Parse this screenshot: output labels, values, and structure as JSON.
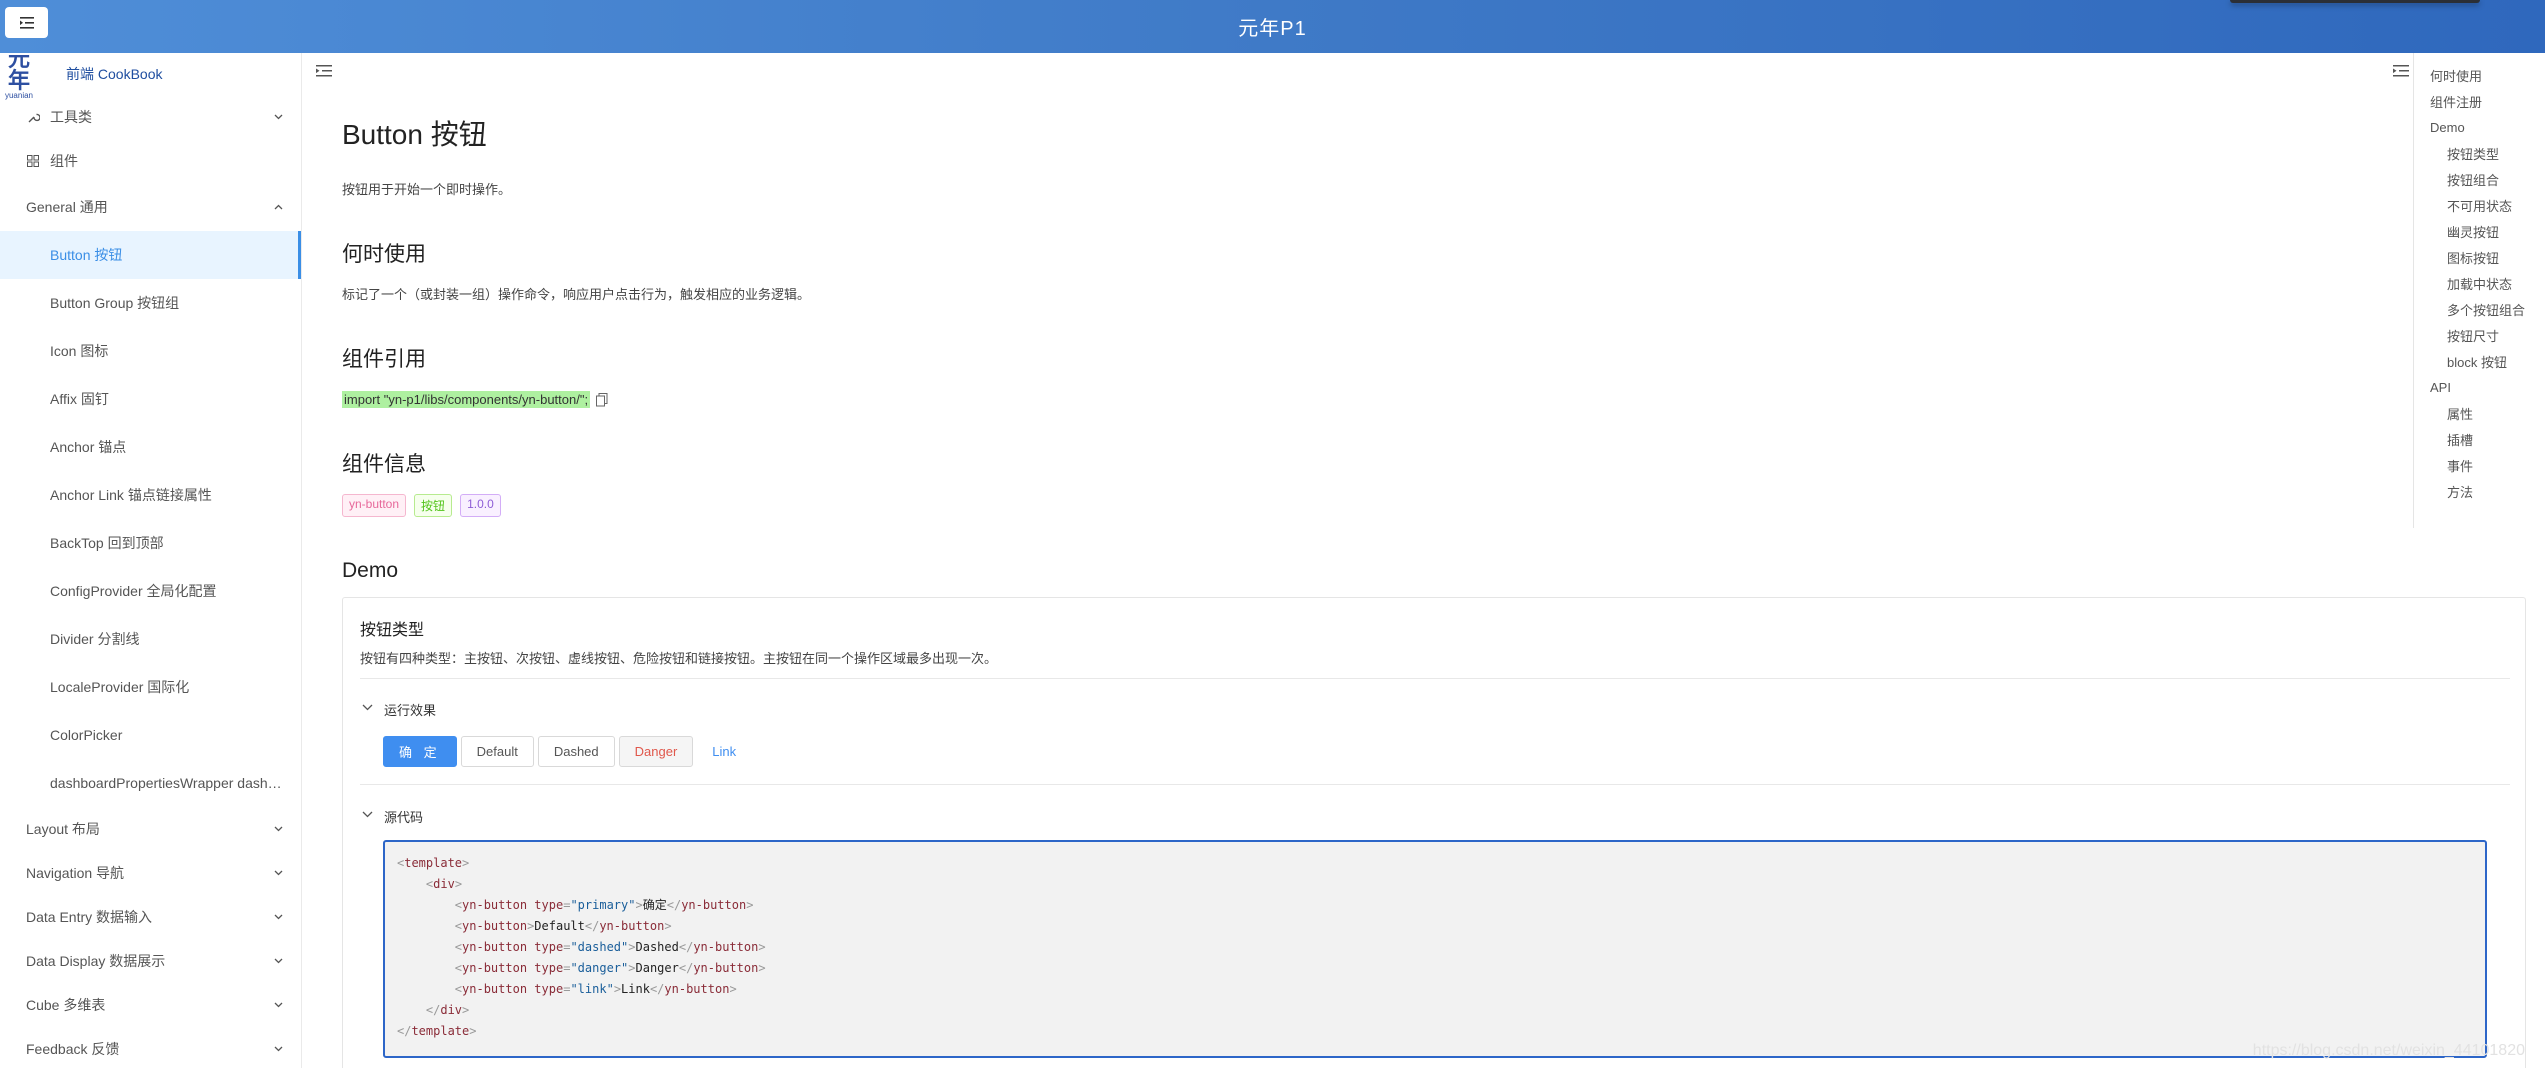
{
  "header": {
    "title": "元年P1"
  },
  "brand": {
    "logo_cn": "元年",
    "logo_en": "yuanian",
    "name": "前端 CookBook"
  },
  "sidebar": {
    "items": [
      {
        "label": "工具类",
        "icon": "wrench-icon",
        "expandable": true
      },
      {
        "label": "组件",
        "icon": "grid-icon",
        "expandable": false
      },
      {
        "label": "General 通用",
        "expanded": true
      },
      {
        "label": "Button 按钮",
        "active": true
      },
      {
        "label": "Button Group 按钮组"
      },
      {
        "label": "Icon 图标"
      },
      {
        "label": "Affix 固钉"
      },
      {
        "label": "Anchor 锚点"
      },
      {
        "label": "Anchor Link 锚点链接属性"
      },
      {
        "label": "BackTop 回到顶部"
      },
      {
        "label": "ConfigProvider 全局化配置"
      },
      {
        "label": "Divider 分割线"
      },
      {
        "label": "LocaleProvider 国际化"
      },
      {
        "label": "ColorPicker"
      },
      {
        "label": "dashboardPropertiesWrapper dashboard属性配置"
      },
      {
        "label": "Layout 布局"
      },
      {
        "label": "Navigation 导航"
      },
      {
        "label": "Data Entry 数据输入"
      },
      {
        "label": "Data Display 数据展示"
      },
      {
        "label": "Cube 多维表"
      },
      {
        "label": "Feedback 反馈"
      }
    ]
  },
  "content": {
    "title": "Button 按钮",
    "description": "按钮用于开始一个即时操作。",
    "when_title": "何时使用",
    "when_text": "标记了一个（或封装一组）操作命令，响应用户点击行为，触发相应的业务逻辑。",
    "import_title": "组件引用",
    "import_code": "import \"yn-p1/libs/components/yn-button/\";",
    "info_title": "组件信息",
    "tags": [
      "yn-button",
      "按钮",
      "1.0.0"
    ],
    "demo_title": "Demo",
    "demo": {
      "title": "按钮类型",
      "desc": "按钮有四种类型：主按钮、次按钮、虚线按钮、危险按钮和链接按钮。主按钮在同一个操作区域最多出现一次。",
      "run_label": "运行效果",
      "source_label": "源代码",
      "buttons": [
        "确 定",
        "Default",
        "Dashed",
        "Danger",
        "Link"
      ],
      "code": {
        "open_template": "template",
        "open_div": "div",
        "lines": [
          {
            "type": "primary",
            "text": "确定"
          },
          {
            "type": "",
            "text": "Default"
          },
          {
            "type": "dashed",
            "text": "Dashed"
          },
          {
            "type": "danger",
            "text": "Danger"
          },
          {
            "type": "link",
            "text": "Link"
          }
        ],
        "tag_name": "yn-button",
        "attr_name": "type"
      }
    }
  },
  "toc": {
    "items": [
      {
        "label": "何时使用",
        "level": 1
      },
      {
        "label": "组件注册",
        "level": 1
      },
      {
        "label": "Demo",
        "level": 1
      },
      {
        "label": "按钮类型",
        "level": 2
      },
      {
        "label": "按钮组合",
        "level": 2
      },
      {
        "label": "不可用状态",
        "level": 2
      },
      {
        "label": "幽灵按钮",
        "level": 2
      },
      {
        "label": "图标按钮",
        "level": 2
      },
      {
        "label": "加载中状态",
        "level": 2
      },
      {
        "label": "多个按钮组合",
        "level": 2
      },
      {
        "label": "按钮尺寸",
        "level": 2
      },
      {
        "label": "block 按钮",
        "level": 2
      },
      {
        "label": "API",
        "level": 1
      },
      {
        "label": "属性",
        "level": 2
      },
      {
        "label": "插槽",
        "level": 2
      },
      {
        "label": "事件",
        "level": 2
      },
      {
        "label": "方法",
        "level": 2
      }
    ]
  },
  "watermark": "https://blog.csdn.net/weixin_44101820",
  "colors": {
    "accent": "#3f8ef0",
    "header": "#3f7ac7",
    "active_bg": "#e8f4ff",
    "danger": "#e0574b"
  }
}
